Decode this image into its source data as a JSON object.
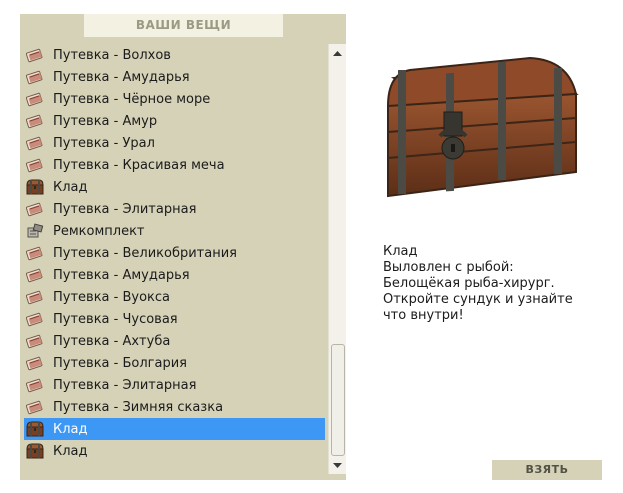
{
  "header": {
    "title": "ВАШИ ВЕЩИ"
  },
  "items": [
    {
      "label": "Путевка - Волхов",
      "icon": "ticket-icon"
    },
    {
      "label": "Путевка - Амударья",
      "icon": "ticket-icon"
    },
    {
      "label": "Путевка - Чёрное море",
      "icon": "ticket-icon"
    },
    {
      "label": "Путевка - Амур",
      "icon": "ticket-icon"
    },
    {
      "label": "Путевка - Урал",
      "icon": "ticket-icon"
    },
    {
      "label": "Путевка - Красивая меча",
      "icon": "ticket-icon"
    },
    {
      "label": "Клад",
      "icon": "chest-icon"
    },
    {
      "label": "Путевка - Элитарная",
      "icon": "ticket-icon"
    },
    {
      "label": "Ремкомплект",
      "icon": "repair-kit-icon"
    },
    {
      "label": "Путевка - Великобритания",
      "icon": "ticket-icon"
    },
    {
      "label": "Путевка - Амударья",
      "icon": "ticket-icon"
    },
    {
      "label": "Путевка - Вуокса",
      "icon": "ticket-icon"
    },
    {
      "label": "Путевка - Чусовая",
      "icon": "ticket-icon"
    },
    {
      "label": "Путевка - Ахтуба",
      "icon": "ticket-icon"
    },
    {
      "label": "Путевка - Болгария",
      "icon": "ticket-icon"
    },
    {
      "label": "Путевка - Элитарная",
      "icon": "ticket-icon"
    },
    {
      "label": "Путевка - Зимняя сказка",
      "icon": "ticket-icon"
    },
    {
      "label": "Клад",
      "icon": "chest-icon",
      "selected": true
    },
    {
      "label": "Клад",
      "icon": "chest-icon"
    }
  ],
  "details": {
    "image_icon": "treasure-chest-icon",
    "lines": [
      "Клад",
      "Выловлен с рыбой:",
      "Белощёкая рыба-хирург.",
      "Откройте сундук и узнайте",
      "что внутри!"
    ]
  },
  "actions": {
    "take_label": "ВЗЯТЬ"
  },
  "colors": {
    "panel": "#d5d2b7",
    "header_bg": "#f3f1e1",
    "selection": "#3d97f5"
  }
}
